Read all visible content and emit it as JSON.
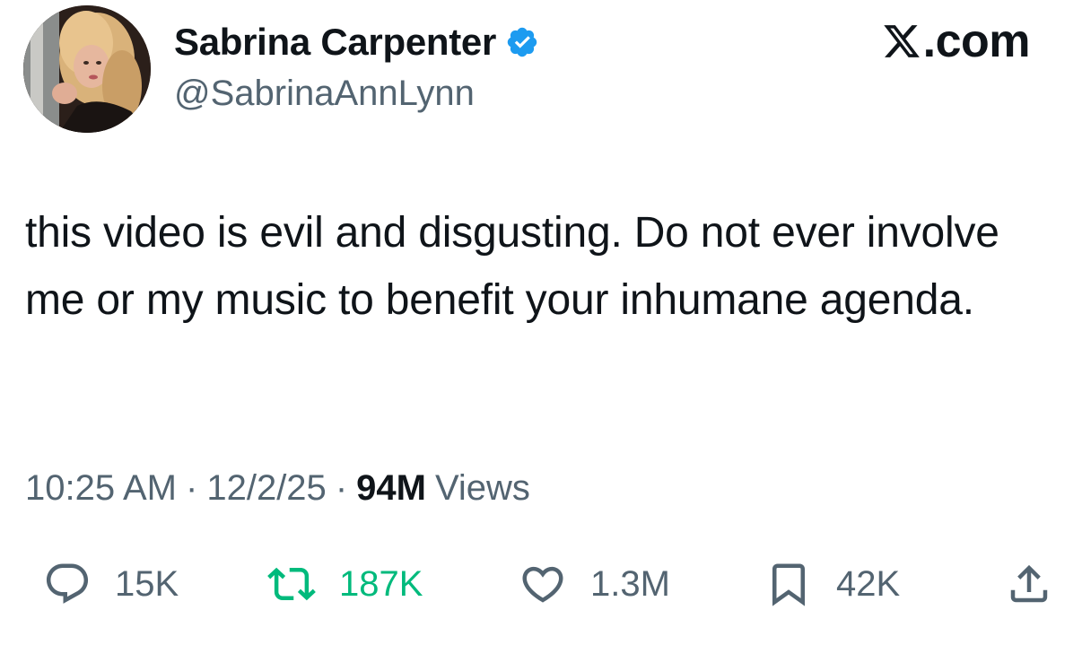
{
  "author": {
    "display_name": "Sabrina Carpenter",
    "handle": "@SabrinaAnnLynn",
    "verified": true,
    "verified_color": "#1d9bf0"
  },
  "brand": {
    "label": ".com",
    "icon": "x-logo-icon"
  },
  "tweet": {
    "text": "this video is evil and disgusting. Do not ever involve me or my music to benefit your inhumane agenda."
  },
  "meta": {
    "time": "10:25 AM",
    "date": "12/2/25",
    "separator": "·",
    "views_count": "94M",
    "views_label": "Views"
  },
  "actions": {
    "reply": {
      "icon": "reply-icon",
      "count": "15K"
    },
    "repost": {
      "icon": "repost-icon",
      "count": "187K",
      "color": "#00ba7c"
    },
    "like": {
      "icon": "heart-icon",
      "count": "1.3M"
    },
    "bookmark": {
      "icon": "bookmark-icon",
      "count": "42K"
    },
    "share": {
      "icon": "share-icon"
    }
  },
  "colors": {
    "text_primary": "#0f1419",
    "text_secondary": "#536471",
    "repost_active": "#00ba7c",
    "verified": "#1d9bf0"
  }
}
